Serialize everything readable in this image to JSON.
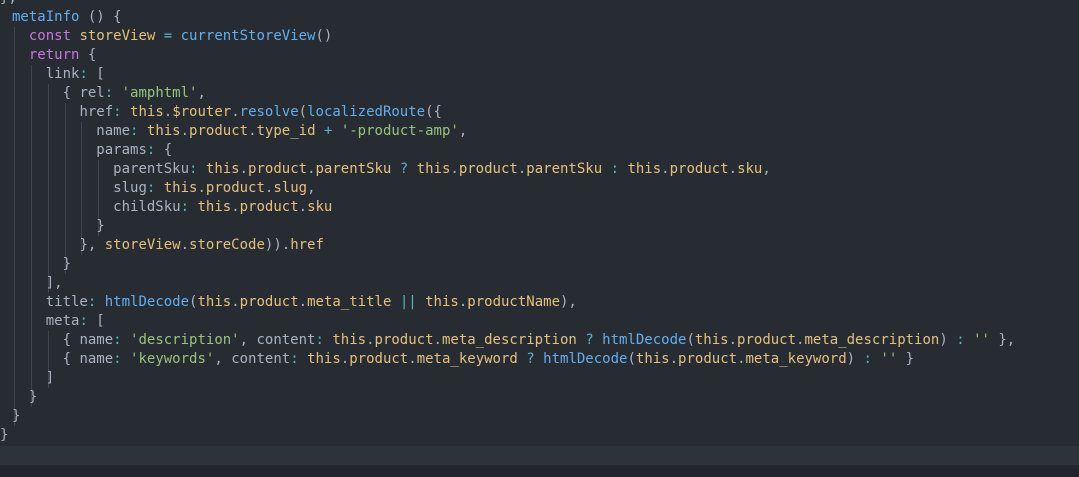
{
  "colors": {
    "background": "#272c33",
    "plain": "#abb2bf",
    "keyword": "#c678dd",
    "function": "#61afef",
    "string": "#98c379",
    "property": "#e06c75",
    "variable": "#e5c07b",
    "operator": "#56b6c2"
  },
  "code": {
    "lines": [
      {
        "indent": 0,
        "guides": 0,
        "tokens": [
          {
            "t": "},",
            "c": "plain"
          }
        ]
      },
      {
        "indent": 1,
        "guides": 0,
        "tokens": [
          {
            "t": "metaInfo",
            "c": "fn"
          },
          {
            "t": " () {",
            "c": "plain"
          }
        ]
      },
      {
        "indent": 2,
        "guides": 1,
        "tokens": [
          {
            "t": "const",
            "c": "key"
          },
          {
            "t": " storeView ",
            "c": "var"
          },
          {
            "t": "=",
            "c": "op"
          },
          {
            "t": " ",
            "c": "plain"
          },
          {
            "t": "currentStoreView",
            "c": "fn"
          },
          {
            "t": "()",
            "c": "plain"
          }
        ]
      },
      {
        "indent": 2,
        "guides": 1,
        "tokens": [
          {
            "t": "return",
            "c": "key"
          },
          {
            "t": " {",
            "c": "plain"
          }
        ]
      },
      {
        "indent": 3,
        "guides": 2,
        "tokens": [
          {
            "t": "link",
            "c": "plain"
          },
          {
            "t": ":",
            "c": "op"
          },
          {
            "t": " [",
            "c": "plain"
          }
        ]
      },
      {
        "indent": 4,
        "guides": 3,
        "tokens": [
          {
            "t": "{ ",
            "c": "plain"
          },
          {
            "t": "rel",
            "c": "plain"
          },
          {
            "t": ":",
            "c": "op"
          },
          {
            "t": " ",
            "c": "plain"
          },
          {
            "t": "'amphtml'",
            "c": "str"
          },
          {
            "t": ",",
            "c": "plain"
          }
        ]
      },
      {
        "indent": 5,
        "guides": 4,
        "tokens": [
          {
            "t": "href",
            "c": "plain"
          },
          {
            "t": ":",
            "c": "op"
          },
          {
            "t": " ",
            "c": "plain"
          },
          {
            "t": "this",
            "c": "this"
          },
          {
            "t": ".",
            "c": "plain"
          },
          {
            "t": "$router",
            "c": "var"
          },
          {
            "t": ".",
            "c": "plain"
          },
          {
            "t": "resolve",
            "c": "fn"
          },
          {
            "t": "(",
            "c": "plain"
          },
          {
            "t": "localizedRoute",
            "c": "fn"
          },
          {
            "t": "({",
            "c": "plain"
          }
        ]
      },
      {
        "indent": 6,
        "guides": 5,
        "tokens": [
          {
            "t": "name",
            "c": "plain"
          },
          {
            "t": ":",
            "c": "op"
          },
          {
            "t": " ",
            "c": "plain"
          },
          {
            "t": "this",
            "c": "this"
          },
          {
            "t": ".",
            "c": "plain"
          },
          {
            "t": "product",
            "c": "var"
          },
          {
            "t": ".",
            "c": "plain"
          },
          {
            "t": "type_id",
            "c": "var"
          },
          {
            "t": " ",
            "c": "plain"
          },
          {
            "t": "+",
            "c": "op"
          },
          {
            "t": " ",
            "c": "plain"
          },
          {
            "t": "'-product-amp'",
            "c": "str"
          },
          {
            "t": ",",
            "c": "plain"
          }
        ]
      },
      {
        "indent": 6,
        "guides": 5,
        "tokens": [
          {
            "t": "params",
            "c": "plain"
          },
          {
            "t": ":",
            "c": "op"
          },
          {
            "t": " {",
            "c": "plain"
          }
        ]
      },
      {
        "indent": 7,
        "guides": 6,
        "tokens": [
          {
            "t": "parentSku",
            "c": "plain"
          },
          {
            "t": ":",
            "c": "op"
          },
          {
            "t": " ",
            "c": "plain"
          },
          {
            "t": "this",
            "c": "this"
          },
          {
            "t": ".",
            "c": "plain"
          },
          {
            "t": "product",
            "c": "var"
          },
          {
            "t": ".",
            "c": "plain"
          },
          {
            "t": "parentSku",
            "c": "var"
          },
          {
            "t": " ",
            "c": "plain"
          },
          {
            "t": "?",
            "c": "op"
          },
          {
            "t": " ",
            "c": "plain"
          },
          {
            "t": "this",
            "c": "this"
          },
          {
            "t": ".",
            "c": "plain"
          },
          {
            "t": "product",
            "c": "var"
          },
          {
            "t": ".",
            "c": "plain"
          },
          {
            "t": "parentSku",
            "c": "var"
          },
          {
            "t": " ",
            "c": "plain"
          },
          {
            "t": ":",
            "c": "op"
          },
          {
            "t": " ",
            "c": "plain"
          },
          {
            "t": "this",
            "c": "this"
          },
          {
            "t": ".",
            "c": "plain"
          },
          {
            "t": "product",
            "c": "var"
          },
          {
            "t": ".",
            "c": "plain"
          },
          {
            "t": "sku",
            "c": "var"
          },
          {
            "t": ",",
            "c": "plain"
          }
        ]
      },
      {
        "indent": 7,
        "guides": 6,
        "tokens": [
          {
            "t": "slug",
            "c": "plain"
          },
          {
            "t": ":",
            "c": "op"
          },
          {
            "t": " ",
            "c": "plain"
          },
          {
            "t": "this",
            "c": "this"
          },
          {
            "t": ".",
            "c": "plain"
          },
          {
            "t": "product",
            "c": "var"
          },
          {
            "t": ".",
            "c": "plain"
          },
          {
            "t": "slug",
            "c": "var"
          },
          {
            "t": ",",
            "c": "plain"
          }
        ]
      },
      {
        "indent": 7,
        "guides": 6,
        "tokens": [
          {
            "t": "childSku",
            "c": "plain"
          },
          {
            "t": ":",
            "c": "op"
          },
          {
            "t": " ",
            "c": "plain"
          },
          {
            "t": "this",
            "c": "this"
          },
          {
            "t": ".",
            "c": "plain"
          },
          {
            "t": "product",
            "c": "var"
          },
          {
            "t": ".",
            "c": "plain"
          },
          {
            "t": "sku",
            "c": "var"
          }
        ]
      },
      {
        "indent": 6,
        "guides": 6,
        "tokens": [
          {
            "t": "}",
            "c": "plain"
          }
        ]
      },
      {
        "indent": 5,
        "guides": 5,
        "tokens": [
          {
            "t": "}, ",
            "c": "plain"
          },
          {
            "t": "storeView",
            "c": "var"
          },
          {
            "t": ".",
            "c": "plain"
          },
          {
            "t": "storeCode",
            "c": "var"
          },
          {
            "t": ")).",
            "c": "plain"
          },
          {
            "t": "href",
            "c": "var"
          }
        ]
      },
      {
        "indent": 4,
        "guides": 4,
        "tokens": [
          {
            "t": "}",
            "c": "plain"
          }
        ]
      },
      {
        "indent": 3,
        "guides": 3,
        "tokens": [
          {
            "t": "],",
            "c": "plain"
          }
        ]
      },
      {
        "indent": 3,
        "guides": 2,
        "tokens": [
          {
            "t": "title",
            "c": "plain"
          },
          {
            "t": ":",
            "c": "op"
          },
          {
            "t": " ",
            "c": "plain"
          },
          {
            "t": "htmlDecode",
            "c": "fn"
          },
          {
            "t": "(",
            "c": "plain"
          },
          {
            "t": "this",
            "c": "this"
          },
          {
            "t": ".",
            "c": "plain"
          },
          {
            "t": "product",
            "c": "var"
          },
          {
            "t": ".",
            "c": "plain"
          },
          {
            "t": "meta_title",
            "c": "var"
          },
          {
            "t": " ",
            "c": "plain"
          },
          {
            "t": "||",
            "c": "op"
          },
          {
            "t": " ",
            "c": "plain"
          },
          {
            "t": "this",
            "c": "this"
          },
          {
            "t": ".",
            "c": "plain"
          },
          {
            "t": "productName",
            "c": "var"
          },
          {
            "t": "),",
            "c": "plain"
          }
        ]
      },
      {
        "indent": 3,
        "guides": 2,
        "tokens": [
          {
            "t": "meta",
            "c": "plain"
          },
          {
            "t": ":",
            "c": "op"
          },
          {
            "t": " [",
            "c": "plain"
          }
        ]
      },
      {
        "indent": 4,
        "guides": 3,
        "tokens": [
          {
            "t": "{ ",
            "c": "plain"
          },
          {
            "t": "name",
            "c": "plain"
          },
          {
            "t": ":",
            "c": "op"
          },
          {
            "t": " ",
            "c": "plain"
          },
          {
            "t": "'description'",
            "c": "str"
          },
          {
            "t": ", ",
            "c": "plain"
          },
          {
            "t": "content",
            "c": "plain"
          },
          {
            "t": ":",
            "c": "op"
          },
          {
            "t": " ",
            "c": "plain"
          },
          {
            "t": "this",
            "c": "this"
          },
          {
            "t": ".",
            "c": "plain"
          },
          {
            "t": "product",
            "c": "var"
          },
          {
            "t": ".",
            "c": "plain"
          },
          {
            "t": "meta_description",
            "c": "var"
          },
          {
            "t": " ",
            "c": "plain"
          },
          {
            "t": "?",
            "c": "op"
          },
          {
            "t": " ",
            "c": "plain"
          },
          {
            "t": "htmlDecode",
            "c": "fn"
          },
          {
            "t": "(",
            "c": "plain"
          },
          {
            "t": "this",
            "c": "this"
          },
          {
            "t": ".",
            "c": "plain"
          },
          {
            "t": "product",
            "c": "var"
          },
          {
            "t": ".",
            "c": "plain"
          },
          {
            "t": "meta_description",
            "c": "var"
          },
          {
            "t": ") ",
            "c": "plain"
          },
          {
            "t": ":",
            "c": "op"
          },
          {
            "t": " ",
            "c": "plain"
          },
          {
            "t": "''",
            "c": "str"
          },
          {
            "t": " },",
            "c": "plain"
          }
        ]
      },
      {
        "indent": 4,
        "guides": 3,
        "tokens": [
          {
            "t": "{ ",
            "c": "plain"
          },
          {
            "t": "name",
            "c": "plain"
          },
          {
            "t": ":",
            "c": "op"
          },
          {
            "t": " ",
            "c": "plain"
          },
          {
            "t": "'keywords'",
            "c": "str"
          },
          {
            "t": ", ",
            "c": "plain"
          },
          {
            "t": "content",
            "c": "plain"
          },
          {
            "t": ":",
            "c": "op"
          },
          {
            "t": " ",
            "c": "plain"
          },
          {
            "t": "this",
            "c": "this"
          },
          {
            "t": ".",
            "c": "plain"
          },
          {
            "t": "product",
            "c": "var"
          },
          {
            "t": ".",
            "c": "plain"
          },
          {
            "t": "meta_keyword",
            "c": "var"
          },
          {
            "t": " ",
            "c": "plain"
          },
          {
            "t": "?",
            "c": "op"
          },
          {
            "t": " ",
            "c": "plain"
          },
          {
            "t": "htmlDecode",
            "c": "fn"
          },
          {
            "t": "(",
            "c": "plain"
          },
          {
            "t": "this",
            "c": "this"
          },
          {
            "t": ".",
            "c": "plain"
          },
          {
            "t": "product",
            "c": "var"
          },
          {
            "t": ".",
            "c": "plain"
          },
          {
            "t": "meta_keyword",
            "c": "var"
          },
          {
            "t": ") ",
            "c": "plain"
          },
          {
            "t": ":",
            "c": "op"
          },
          {
            "t": " ",
            "c": "plain"
          },
          {
            "t": "''",
            "c": "str"
          },
          {
            "t": " }",
            "c": "plain"
          }
        ]
      },
      {
        "indent": 3,
        "guides": 3,
        "tokens": [
          {
            "t": "]",
            "c": "plain"
          }
        ]
      },
      {
        "indent": 2,
        "guides": 2,
        "tokens": [
          {
            "t": "}",
            "c": "plain"
          }
        ]
      },
      {
        "indent": 1,
        "guides": 1,
        "tokens": [
          {
            "t": "}",
            "c": "plain"
          }
        ]
      },
      {
        "indent": 0,
        "guides": 0,
        "tokens": [
          {
            "t": "}",
            "c": "plain"
          }
        ]
      }
    ]
  }
}
